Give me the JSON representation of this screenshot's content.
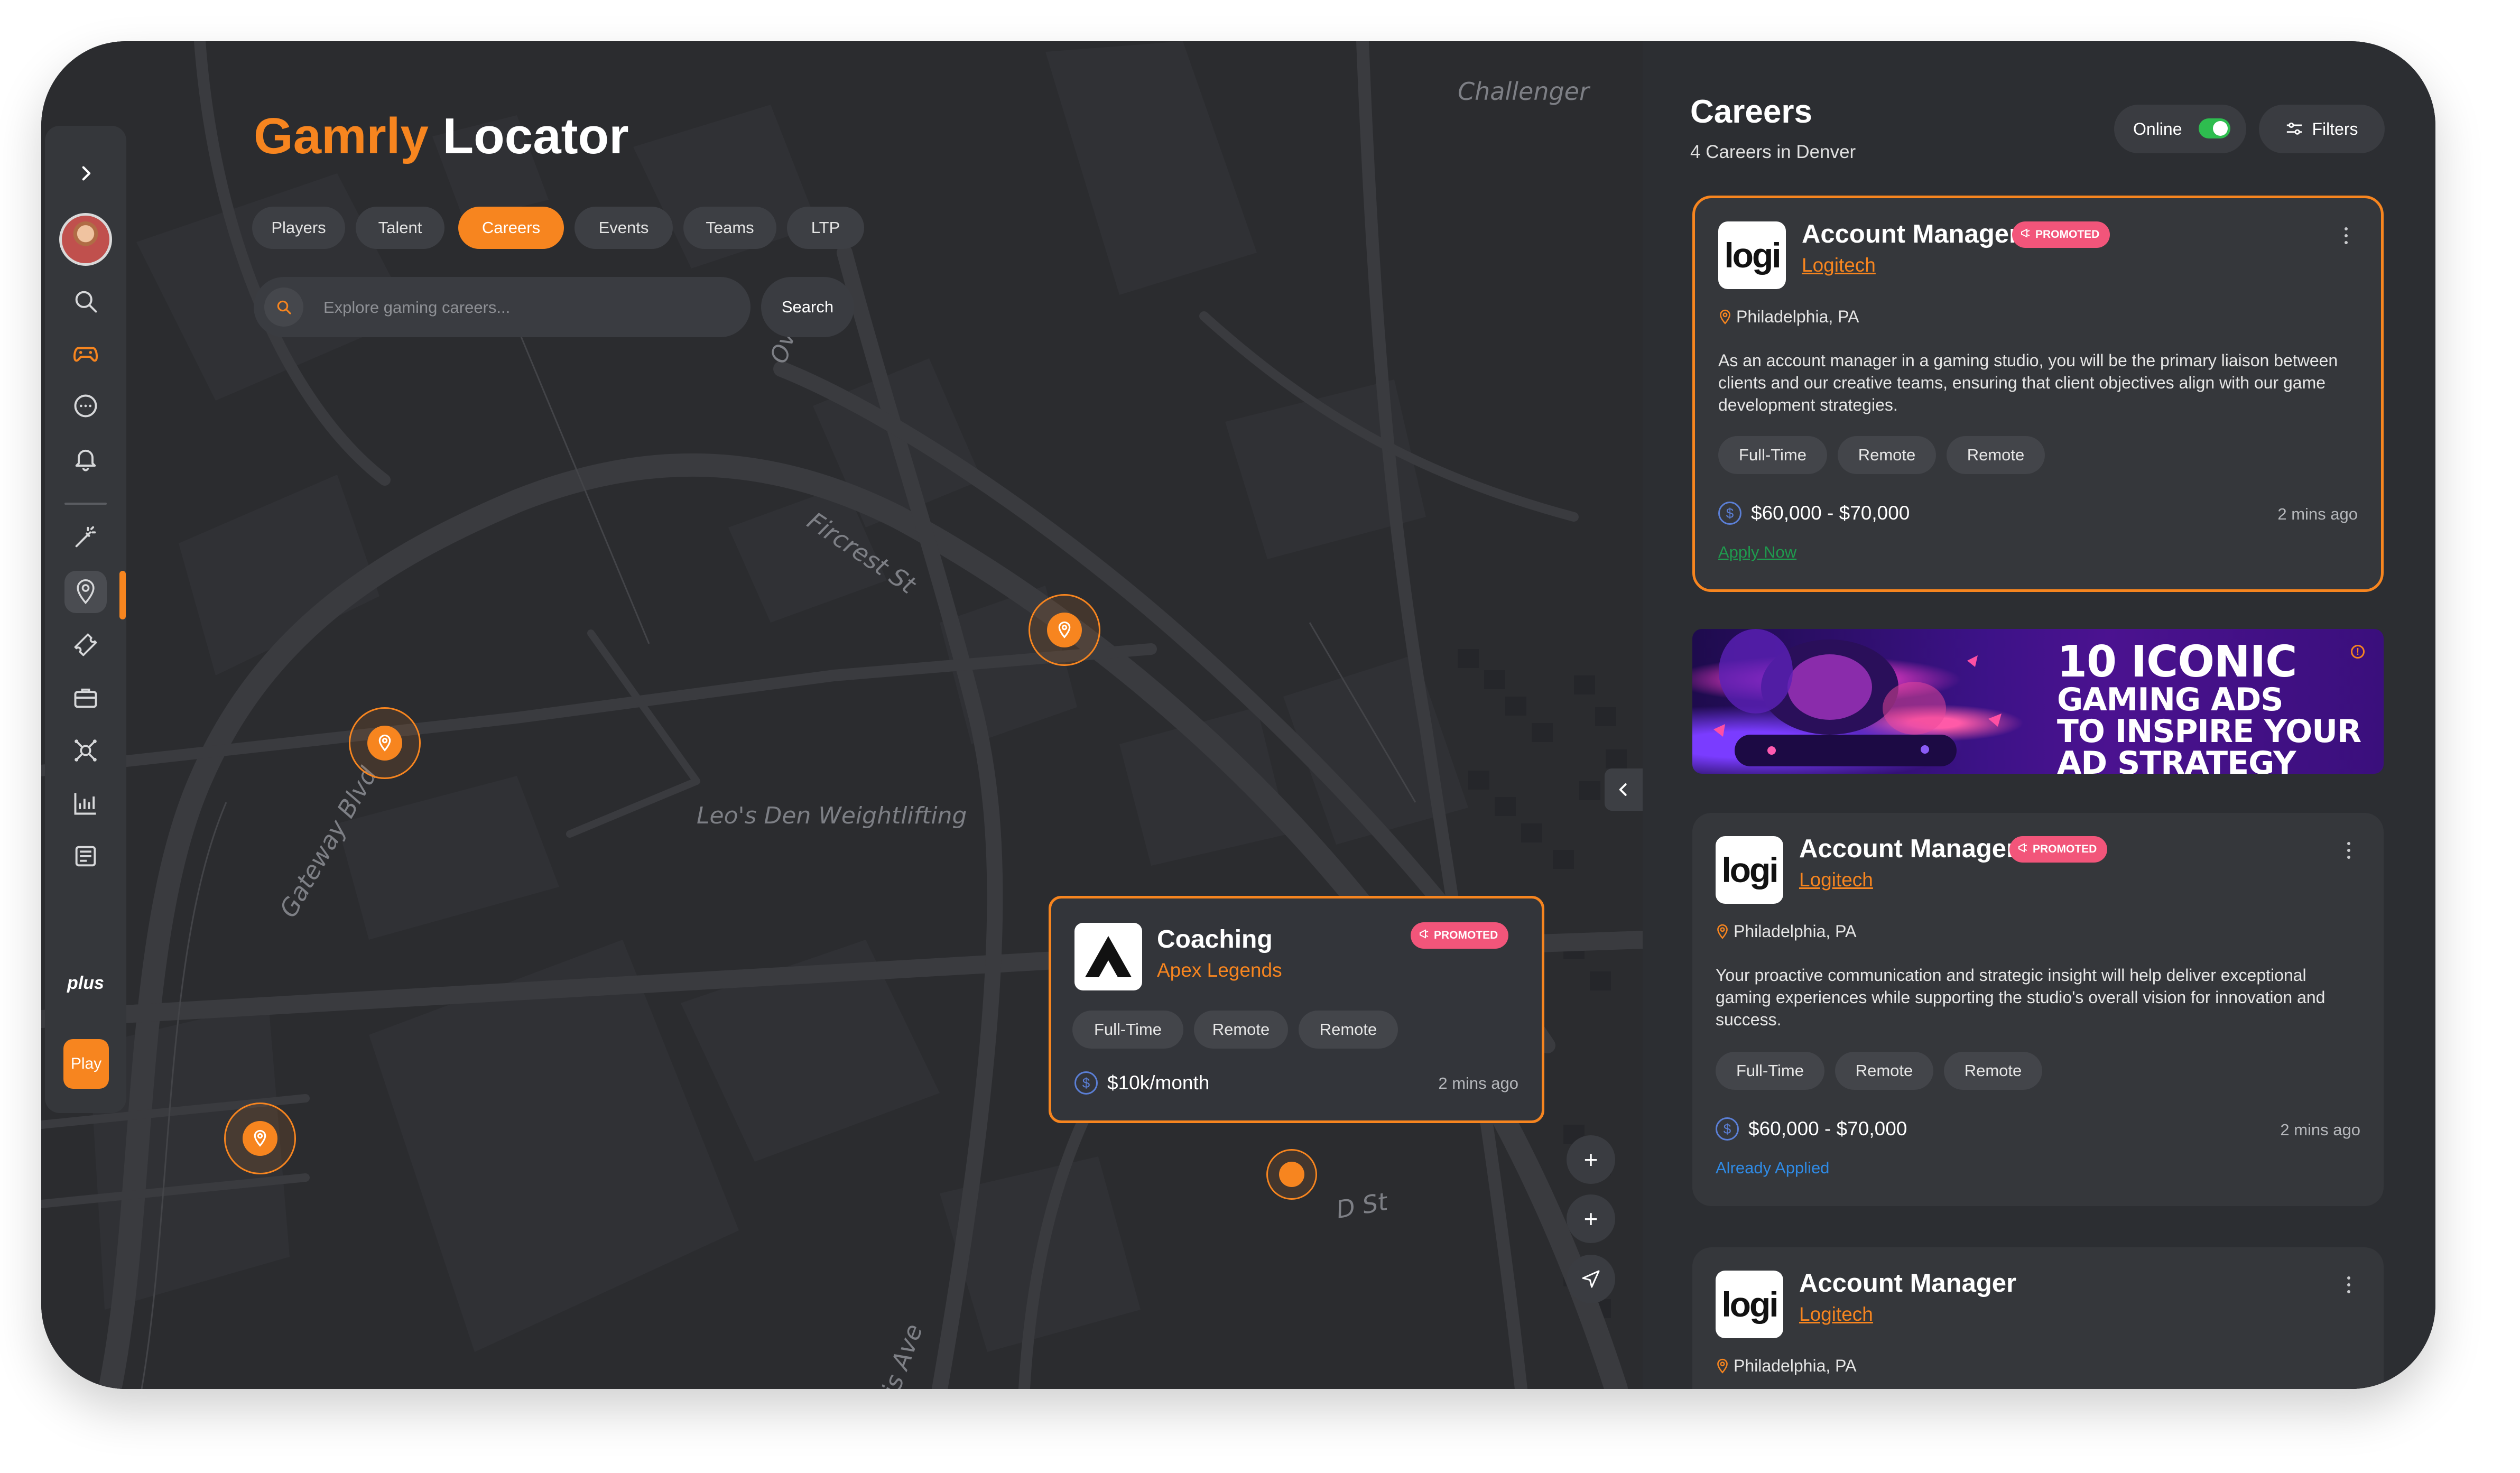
{
  "app": {
    "title_brand": "Gamrly",
    "title_rest": " Locator"
  },
  "sidebar": {
    "plus_label": "plus",
    "play_label": "Play",
    "icons": [
      "chevron-right-icon",
      "search-icon",
      "gamepad-icon",
      "chat-icon",
      "bell-icon",
      "magic-wand-icon",
      "location-icon",
      "ticket-icon",
      "briefcase-icon",
      "network-icon",
      "chart-icon",
      "news-icon"
    ]
  },
  "tabs": [
    {
      "label": "Players"
    },
    {
      "label": "Talent"
    },
    {
      "label": "Careers",
      "active": true
    },
    {
      "label": "Events"
    },
    {
      "label": "Teams"
    },
    {
      "label": "LTP"
    }
  ],
  "search": {
    "placeholder": "Explore gaming careers...",
    "button_label": "Search"
  },
  "map": {
    "labels": {
      "challenger": "Challenger",
      "overland": "Overla",
      "fircrest": "Fircrest St",
      "gateway": "Gateway Blvd",
      "leos_den": "Leo's Den Weightlifting",
      "d_st": "D St",
      "ave": "is Ave"
    },
    "controls": {
      "zoom_in": "+",
      "zoom_out": "+"
    },
    "popup": {
      "title": "Coaching",
      "company": "Apex Legends",
      "badge": "PROMOTED",
      "tags": [
        "Full-Time",
        "Remote",
        "Remote"
      ],
      "salary": "$10k/month",
      "time": "2 mins ago"
    }
  },
  "panel": {
    "title": "Careers",
    "subtitle": "4 Careers in Denver",
    "online_label": "Online",
    "online_on": true,
    "filters_label": "Filters",
    "jobs": [
      {
        "logo": "logi",
        "title": "Account Manager",
        "badge": "PROMOTED",
        "company": "Logitech",
        "location": "Philadelphia, PA",
        "description": "As an account manager in a gaming studio, you will be the primary liaison between clients and our creative teams, ensuring that client objectives align with our game development strategies.",
        "tags": [
          "Full-Time",
          "Remote",
          "Remote"
        ],
        "salary": "$60,000 - $70,000",
        "time": "2 mins ago",
        "action": "Apply Now"
      },
      {
        "logo": "logi",
        "title": "Account Manager",
        "badge": "PROMOTED",
        "company": "Logitech",
        "location": "Philadelphia, PA",
        "description": "Your proactive communication and strategic insight will help deliver exceptional gaming experiences while supporting the studio's overall vision for innovation and success.",
        "tags": [
          "Full-Time",
          "Remote",
          "Remote"
        ],
        "salary": "$60,000 - $70,000",
        "time": "2 mins ago",
        "action": "Already Applied"
      },
      {
        "logo": "logi",
        "title": "Account Manager",
        "company": "Logitech",
        "location": "Philadelphia, PA"
      }
    ],
    "ad": {
      "line1": "10 ICONIC",
      "line2": "GAMING ADS",
      "line3": "TO INSPIRE YOUR",
      "line4": "AD STRATEGY"
    }
  },
  "colors": {
    "accent": "#f7851f",
    "promoted": "#f2557a",
    "apply_green": "#1f9a4e",
    "applied_blue": "#2f8be6",
    "online_green": "#2ebd4f"
  }
}
